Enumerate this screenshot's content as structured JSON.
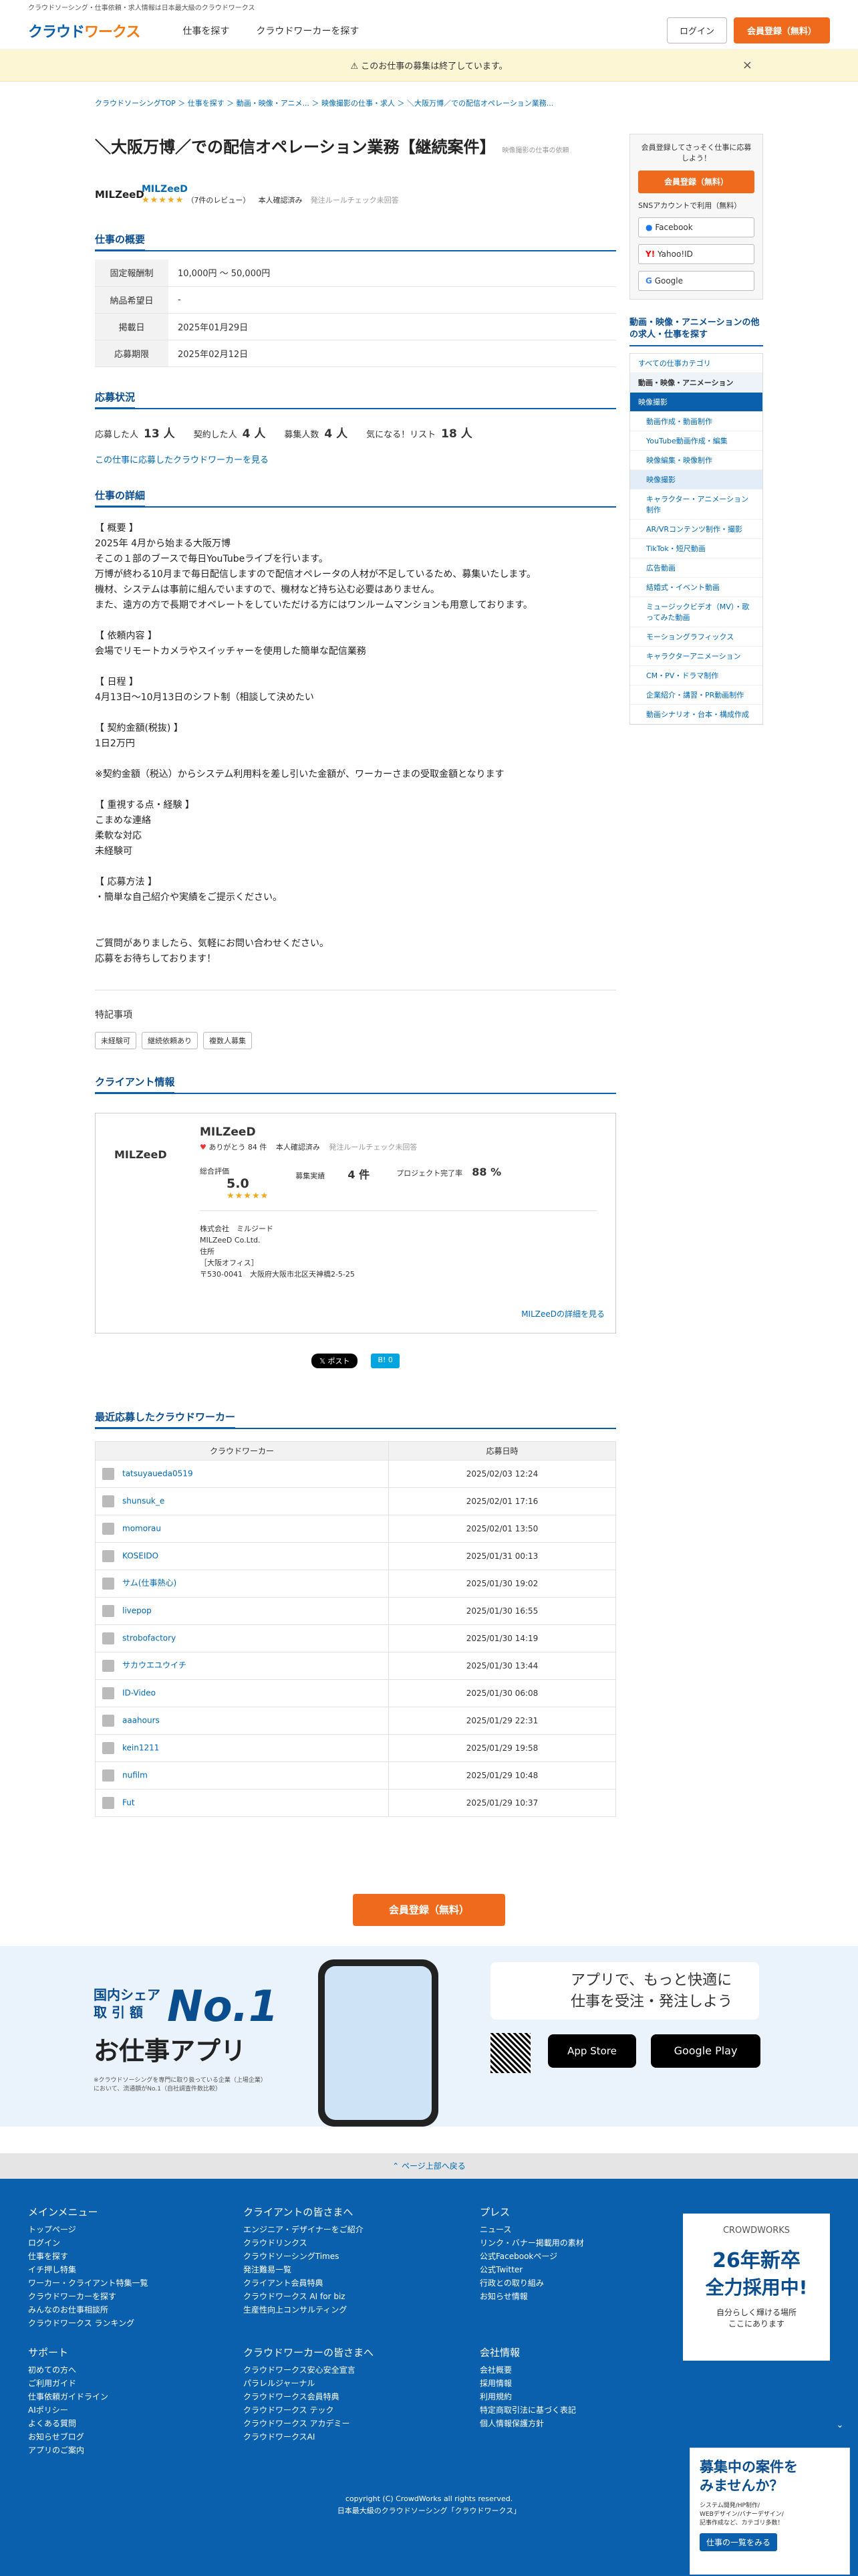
{
  "topbar": "クラウドソーシング・仕事依頼・求人情報は日本最大級のクラウドワークス",
  "header": {
    "logo_a": "クラウド",
    "logo_b": "ワークス",
    "nav": [
      "仕事を探す",
      "クラウドワーカーを探す"
    ],
    "login": "ログイン",
    "signup": "会員登録（無料）"
  },
  "notice": {
    "text": "⚠ このお仕事の募集は終了しています。",
    "close": "×"
  },
  "breadcrumb": "クラウドソーシングTOP ＞ 仕事を探す ＞ 動画・映像・アニメ... ＞ 映像撮影の仕事・求人 ＞ ＼大阪万博／での配信オペレーション業務...",
  "job": {
    "title": "＼大阪万博／での配信オペレーション業務【継続案件】",
    "category": "映像撮影の仕事の依頼"
  },
  "client": {
    "logo": "MILZeeD",
    "name": "MILZeeD",
    "stars": "★★★★★",
    "reviews": "（7件のレビュー）",
    "verified": "本人確認済み",
    "rule": "発注ルールチェック未回答"
  },
  "summary": {
    "heading": "仕事の概要",
    "rows": [
      {
        "k": "固定報酬制",
        "v": "10,000円 〜 50,000円"
      },
      {
        "k": "納品希望日",
        "v": "-"
      },
      {
        "k": "掲載日",
        "v": "2025年01月29日"
      },
      {
        "k": "応募期限",
        "v": "2025年02月12日"
      }
    ]
  },
  "status": {
    "heading": "応募状況",
    "applied_l": "応募した人",
    "applied": "13 人",
    "contracted_l": "契約した人",
    "contracted": "4 人",
    "recruit_l": "募集人数",
    "recruit": "4 人",
    "watch_l": "気になる！リスト",
    "watch": "18 人",
    "link": "この仕事に応募したクラウドワーカーを見る"
  },
  "detail": {
    "heading": "仕事の詳細",
    "body": "【 概要 】\n2025年 4月から始まる大阪万博\nそこの１部のブースで毎日YouTubeライブを行います。\n万博が終わる10月まで毎日配信しますので配信オペレータの人材が不足しているため、募集いたします。\n機材、システムは事前に組んでいますので、機材など持ち込む必要はありません。\nまた、遠方の方で長期でオペレートをしていただける方にはワンルームマンションも用意しております。\n\n【 依頼内容 】\n会場でリモートカメラやスイッチャーを使用した簡単な配信業務\n\n【 日程 】\n4月13日〜10月13日のシフト制（相談して決めたい\n\n【 契約金額(税抜) 】\n1日2万円\n\n※契約金額（税込）からシステム利用料を差し引いた金額が、ワーカーさまの受取金額となります\n\n【 重視する点・経験 】\nこまめな連絡\n柔軟な対応\n未経験可\n\n【 応募方法 】\n・簡単な自己紹介や実績をご提示ください。\n\n\nご質問がありましたら、気軽にお問い合わせください。\n応募をお待ちしております！"
  },
  "special": {
    "heading": "特記事項",
    "tags": [
      "未経験可",
      "継続依頼あり",
      "複数人募集"
    ]
  },
  "clientinfo": {
    "heading": "クライアント情報",
    "name": "MILZeeD",
    "thanks": "ありがとう 84 件",
    "verified": "本人確認済み",
    "rule": "発注ルールチェック未回答",
    "rating_l": "総合評価",
    "rating": "5.0",
    "stars": "★★★★★",
    "orders_l": "募集実績",
    "orders": "4 件",
    "complete_l": "プロジェクト完了率",
    "complete": "88 %",
    "company": "株式会社　ミルジード\nMILZeeD Co.Ltd.\n住所\n［大阪オフィス］\n〒530-0041　大阪府大阪市北区天神橋2-5-25",
    "more": "MILZeeDの詳細を見る"
  },
  "share": {
    "post": "𝕏 ポスト",
    "hatena": "B! 0"
  },
  "applicants": {
    "heading": "最近応募したクラウドワーカー",
    "col1": "クラウドワーカー",
    "col2": "応募日時",
    "rows": [
      {
        "n": "tatsuyaueda0519",
        "d": "2025/02/03 12:24"
      },
      {
        "n": "shunsuk_e",
        "d": "2025/02/01 17:16"
      },
      {
        "n": "momorau",
        "d": "2025/02/01 13:50"
      },
      {
        "n": "KOSEIDO",
        "d": "2025/01/31 00:13"
      },
      {
        "n": "サム(仕事熱心)",
        "d": "2025/01/30 19:02"
      },
      {
        "n": "livepop",
        "d": "2025/01/30 16:55"
      },
      {
        "n": "strobofactory",
        "d": "2025/01/30 14:19"
      },
      {
        "n": "サカウエユウイチ",
        "d": "2025/01/30 13:44"
      },
      {
        "n": "ID-Video",
        "d": "2025/01/30 06:08"
      },
      {
        "n": "aaahours",
        "d": "2025/01/29 22:31"
      },
      {
        "n": "kein1211",
        "d": "2025/01/29 19:58"
      },
      {
        "n": "nufilm",
        "d": "2025/01/29 10:48"
      },
      {
        "n": "Fut",
        "d": "2025/01/29 10:37"
      }
    ]
  },
  "cta": "会員登録（無料）",
  "banner": {
    "top": "国内シェア\n取 引 額",
    "no1": "No.1",
    "app": "お仕事アプリ",
    "note": "※クラウドソーシングを専門に取り扱っている企業（上場企業）において、流通額がNo.1（自社調査件数比較）",
    "msg": "アプリで、もっと快適に\n仕事を受注・発注しよう",
    "appstore": "App Store",
    "gplay": "Google Play"
  },
  "pagetop": "⌃ ページ上部へ戻る",
  "footer": {
    "menu": {
      "h": "メインメニュー",
      "items": [
        "トップページ",
        "ログイン",
        "仕事を探す",
        "イチ押し特集",
        "ワーカー・クライアント特集一覧",
        "クラウドワーカーを探す",
        "みんなのお仕事相談所",
        "クラウドワークス ランキング"
      ]
    },
    "client": {
      "h": "クライアントの皆さまへ",
      "items": [
        "エンジニア・デザイナーをご紹介",
        "クラウドリンクス",
        "クラウドソーシングTimes",
        "発注難易一覧",
        "クライアント会員特典",
        "クラウドワークス AI for biz",
        "生産性向上コンサルティング"
      ]
    },
    "press": {
      "h": "プレス",
      "items": [
        "ニュース",
        "リンク・バナー掲載用の素材",
        "公式Facebookページ",
        "公式Twitter",
        "行政との取り組み",
        "お知らせ情報"
      ]
    },
    "support": {
      "h": "サポート",
      "items": [
        "初めての方へ",
        "ご利用ガイド",
        "仕事依頼ガイドライン",
        "AIポリシー",
        "よくある質問",
        "お知らせブログ",
        "アプリのご案内"
      ]
    },
    "worker": {
      "h": "クラウドワーカーの皆さまへ",
      "items": [
        "クラウドワークス安心安全宣言",
        "パラレルジャーナル",
        "クラウドワークス会員特典",
        "クラウドワークス テック",
        "クラウドワークス アカデミー",
        "クラウドワークスAI"
      ]
    },
    "company": {
      "h": "会社情報",
      "items": [
        "会社概要",
        "採用情報",
        "利用規約",
        "特定商取引法に基づく表記",
        "個人情報保護方針"
      ]
    },
    "copyright": "copyright (C) CrowdWorks all rights reserved.\n日本最大級のクラウドソーシング「クラウドワークス」",
    "recruit": {
      "brand": "CROWDWORKS",
      "l1": "26年新卒",
      "l2": "全力採用中!",
      "l3": "自分らしく輝ける場所\nここにあります"
    }
  },
  "floatad": {
    "title": "募集中の案件を\nみませんか？",
    "sub": "システム開発/HP制作/\nWEBデザイン/バナーデザイン/\n記事作成など、カテゴリ多数！",
    "btn": "仕事の一覧をみる"
  },
  "sidebar": {
    "cta_title": "会員登録してさっそく仕事に応募しよう！",
    "cta_btn": "会員登録（無料）",
    "sns_label": "SNSアカウントで利用（無料）",
    "fb": "Facebook",
    "yahoo": "Yahoo!ID",
    "google": "Google",
    "related": "動画・映像・アニメーションの他の求人・仕事を探す",
    "cats": [
      "すべての仕事カテゴリ",
      "動画・映像・アニメーション",
      "映像撮影",
      "動画作成・動画制作",
      "YouTube動画作成・編集",
      "映像編集・映像制作",
      "映像撮影",
      "キャラクター・アニメーション制作",
      "AR/VRコンテンツ制作・撮影",
      "TikTok・短尺動画",
      "広告動画",
      "結婚式・イベント動画",
      "ミュージックビデオ（MV）・歌ってみた動画",
      "モーショングラフィックス",
      "キャラクターアニメーション",
      "CM・PV・ドラマ制作",
      "企業紹介・講習・PR動画制作",
      "動画シナリオ・台本・構成作成"
    ]
  },
  "colors": {
    "brand": "#0a60ad",
    "accent": "#f06a1d",
    "footer": "#0a60ad"
  }
}
